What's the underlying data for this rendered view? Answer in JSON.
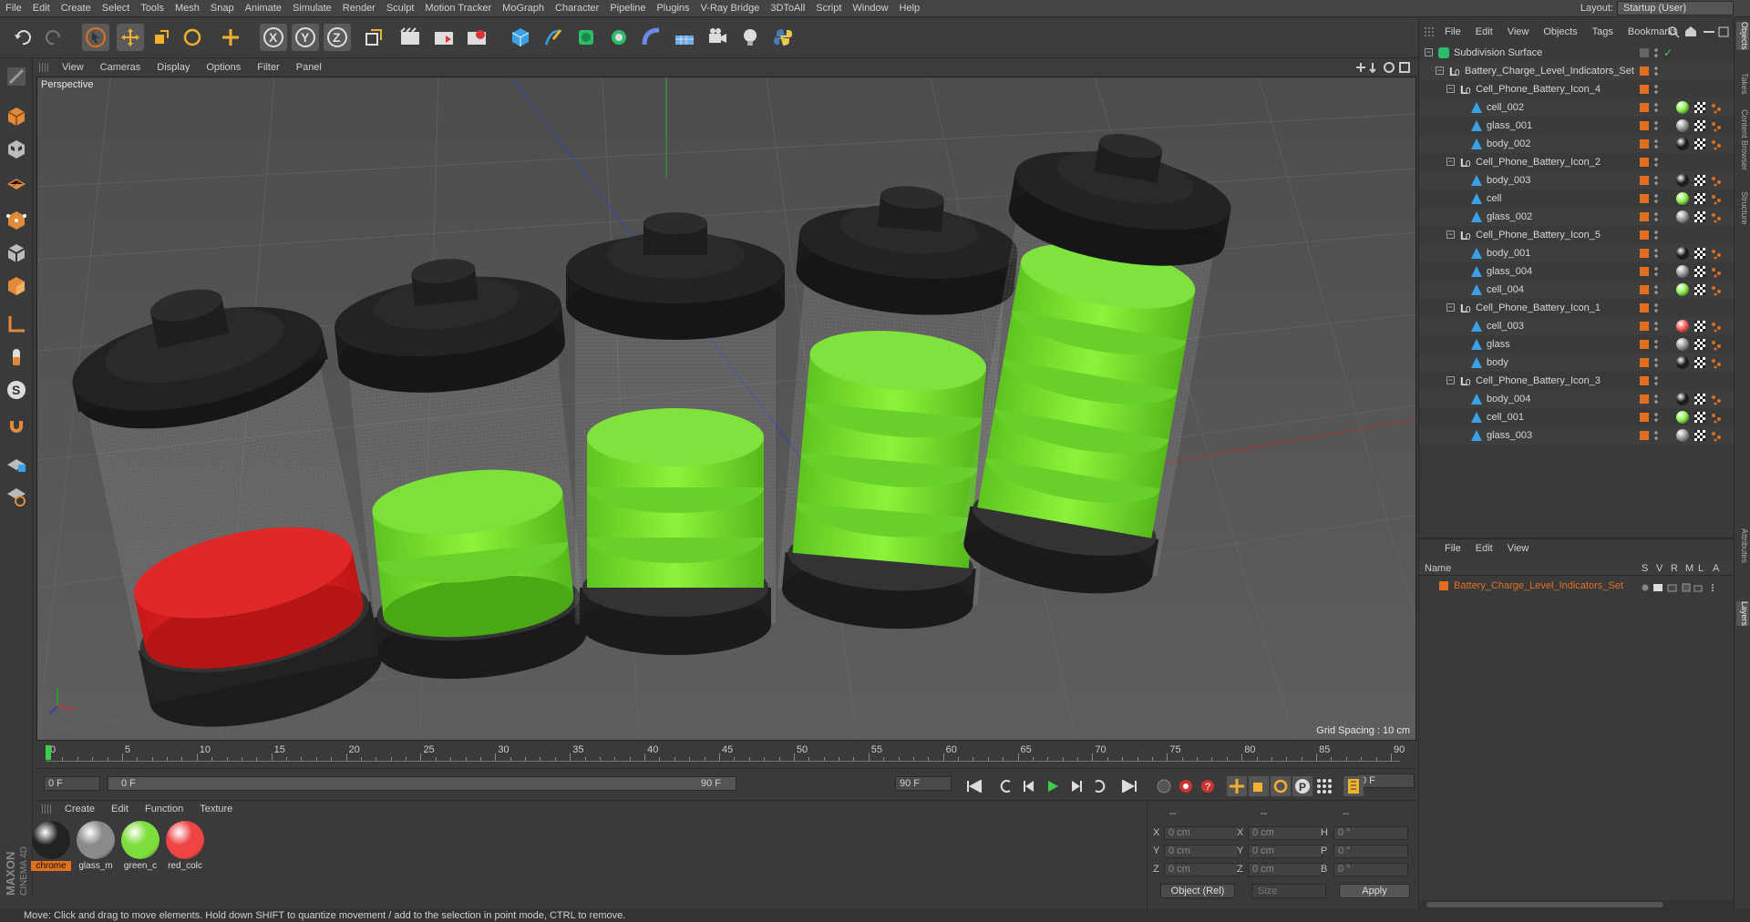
{
  "menubar": [
    "File",
    "Edit",
    "Create",
    "Select",
    "Tools",
    "Mesh",
    "Snap",
    "Animate",
    "Simulate",
    "Render",
    "Sculpt",
    "Motion Tracker",
    "MoGraph",
    "Character",
    "Pipeline",
    "Plugins",
    "V-Ray Bridge",
    "3DToAll",
    "Script",
    "Window",
    "Help"
  ],
  "layout": {
    "label": "Layout:",
    "value": "Startup (User)"
  },
  "viewport": {
    "menu": [
      "View",
      "Cameras",
      "Display",
      "Options",
      "Filter",
      "Panel"
    ],
    "label": "Perspective",
    "grid_spacing": "Grid Spacing : 10 cm"
  },
  "timeline": {
    "ticks": [
      "0",
      "5",
      "10",
      "15",
      "20",
      "25",
      "30",
      "35",
      "40",
      "45",
      "50",
      "55",
      "60",
      "65",
      "70",
      "75",
      "80",
      "85",
      "90"
    ],
    "current_frame": "0 F",
    "start_field": "0 F",
    "range_start": "0 F",
    "range_end": "90 F",
    "end_field": "90 F"
  },
  "material_manager": {
    "menu": [
      "Create",
      "Edit",
      "Function",
      "Texture"
    ],
    "materials": [
      {
        "name": "chrome",
        "color": "#222222",
        "selected": true
      },
      {
        "name": "glass_m",
        "color": "#8a8a8a",
        "selected": false
      },
      {
        "name": "green_c",
        "color": "#7ddd3a",
        "selected": false
      },
      {
        "name": "red_colc",
        "color": "#ee4444",
        "selected": false
      }
    ]
  },
  "coordinates": {
    "header": [
      "--",
      "--",
      "--"
    ],
    "rows": [
      {
        "a": "X",
        "av": "0 cm",
        "b": "X",
        "bv": "0 cm",
        "c": "H",
        "cv": "0 °"
      },
      {
        "a": "Y",
        "av": "0 cm",
        "b": "Y",
        "bv": "0 cm",
        "c": "P",
        "cv": "0 °"
      },
      {
        "a": "Z",
        "av": "0 cm",
        "b": "Z",
        "bv": "0 cm",
        "c": "B",
        "cv": "0 °"
      }
    ],
    "mode": "Object (Rel)",
    "size": "Size",
    "apply": "Apply"
  },
  "status": "Move: Click and drag to move elements. Hold down SHIFT to quantize movement / add to the selection in point mode, CTRL to remove.",
  "object_manager": {
    "menu": [
      "File",
      "Edit",
      "View",
      "Objects",
      "Tags",
      "Bookmarks"
    ],
    "objects": [
      {
        "name": "Subdivision Surface",
        "indent": 0,
        "type": "subdiv",
        "tag": ""
      },
      {
        "name": "Battery_Charge_Level_Indicators_Set",
        "indent": 1,
        "type": "null",
        "tag": ""
      },
      {
        "name": "Cell_Phone_Battery_Icon_4",
        "indent": 2,
        "type": "null",
        "tag": ""
      },
      {
        "name": "cell_002",
        "indent": 3,
        "type": "poly",
        "tag": "green"
      },
      {
        "name": "glass_001",
        "indent": 3,
        "type": "poly",
        "tag": "glass"
      },
      {
        "name": "body_002",
        "indent": 3,
        "type": "poly",
        "tag": "chrome"
      },
      {
        "name": "Cell_Phone_Battery_Icon_2",
        "indent": 2,
        "type": "null",
        "tag": ""
      },
      {
        "name": "body_003",
        "indent": 3,
        "type": "poly",
        "tag": "chrome"
      },
      {
        "name": "cell",
        "indent": 3,
        "type": "poly",
        "tag": "green"
      },
      {
        "name": "glass_002",
        "indent": 3,
        "type": "poly",
        "tag": "glass"
      },
      {
        "name": "Cell_Phone_Battery_Icon_5",
        "indent": 2,
        "type": "null",
        "tag": ""
      },
      {
        "name": "body_001",
        "indent": 3,
        "type": "poly",
        "tag": "chrome"
      },
      {
        "name": "glass_004",
        "indent": 3,
        "type": "poly",
        "tag": "glass"
      },
      {
        "name": "cell_004",
        "indent": 3,
        "type": "poly",
        "tag": "green"
      },
      {
        "name": "Cell_Phone_Battery_Icon_1",
        "indent": 2,
        "type": "null",
        "tag": ""
      },
      {
        "name": "cell_003",
        "indent": 3,
        "type": "poly",
        "tag": "red"
      },
      {
        "name": "glass",
        "indent": 3,
        "type": "poly",
        "tag": "glass"
      },
      {
        "name": "body",
        "indent": 3,
        "type": "poly",
        "tag": "chrome"
      },
      {
        "name": "Cell_Phone_Battery_Icon_3",
        "indent": 2,
        "type": "null",
        "tag": ""
      },
      {
        "name": "body_004",
        "indent": 3,
        "type": "poly",
        "tag": "chrome"
      },
      {
        "name": "cell_001",
        "indent": 3,
        "type": "poly",
        "tag": "green"
      },
      {
        "name": "glass_003",
        "indent": 3,
        "type": "poly",
        "tag": "glass"
      }
    ]
  },
  "layer_manager": {
    "menu": [
      "File",
      "Edit",
      "View"
    ],
    "headers": {
      "name": "Name",
      "s": "S",
      "v": "V",
      "r": "R",
      "m": "M",
      "l": "L",
      "a": "A"
    },
    "layers": [
      {
        "name": "Battery_Charge_Level_Indicators_Set",
        "color": "#e07020"
      }
    ]
  },
  "right_tabs": [
    "Objects",
    "Takes",
    "Content Browser",
    "Structure",
    "Attributes",
    "Layers"
  ],
  "brand": {
    "maxon": "MAXON",
    "product": "CINEMA 4D"
  },
  "colors": {
    "accent": "#e07020",
    "green": "#7ddd3a",
    "red": "#e03030",
    "chrome": "#1e1e1e"
  }
}
